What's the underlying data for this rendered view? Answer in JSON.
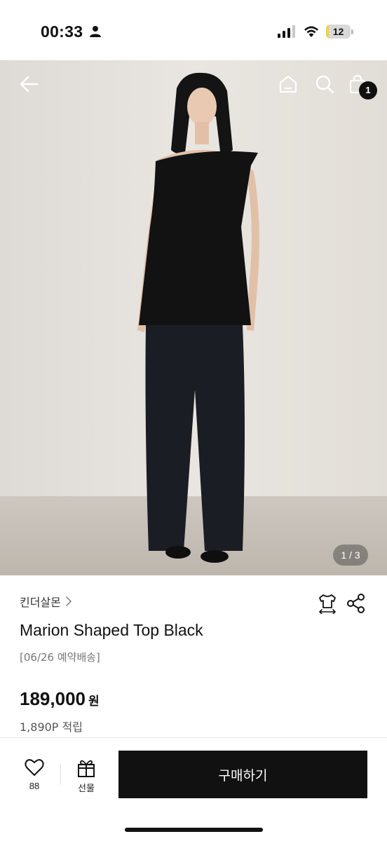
{
  "status_bar": {
    "time": "00:33",
    "battery_level": "12",
    "battery_fraction": 0.12
  },
  "product_image": {
    "alt": "",
    "pager_current": "1",
    "pager_total": "3",
    "pager_text": "1 / 3"
  },
  "header": {
    "cart_count": "1",
    "icons": [
      "back-arrow-icon",
      "home-icon",
      "search-icon",
      "shopping-bag-icon"
    ]
  },
  "product": {
    "brand": "킨더살몬",
    "title": "Marion Shaped Top Black",
    "delivery_note": "[06/26 예약배송]",
    "price": "189,000",
    "price_unit": "원",
    "points": "1,890P 적립"
  },
  "bottom_bar": {
    "like_count": "88",
    "gift_label": "선물",
    "buy_label": "구매하기"
  },
  "colors": {
    "accent": "#111111",
    "battery": "#f1d33a",
    "background": "#ffffff"
  }
}
